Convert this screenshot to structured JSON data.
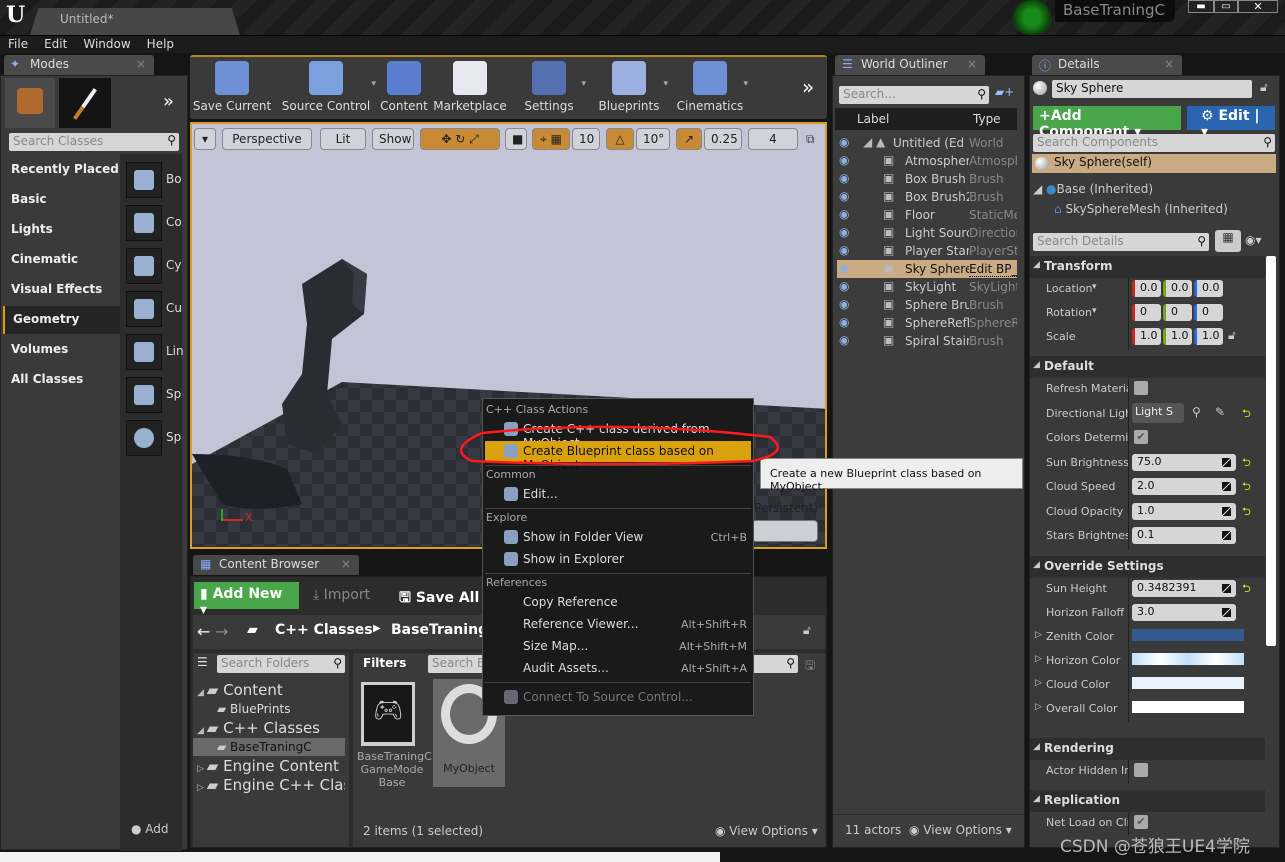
{
  "window": {
    "tab": "Untitled*",
    "project": "BaseTraningC",
    "controls": [
      "minimize",
      "maximize",
      "close"
    ]
  },
  "menu": [
    "File",
    "Edit",
    "Window",
    "Help"
  ],
  "modes": {
    "tab": "Modes",
    "search_placeholder": "Search Classes",
    "categories": [
      "Recently Placed",
      "Basic",
      "Lights",
      "Cinematic",
      "Visual Effects",
      "Geometry",
      "Volumes",
      "All Classes"
    ],
    "selected": "Geometry",
    "items": [
      "Bo",
      "Co",
      "Cy",
      "Cu",
      "Lin",
      "Sp",
      "Sp"
    ],
    "footer": "Add"
  },
  "toolbar": [
    {
      "label": "Save Current",
      "icon": "floppy-icon",
      "color": "#6d8fd6"
    },
    {
      "label": "Source Control",
      "icon": "source-control-icon",
      "color": "#7aa0e0",
      "dropdown": true
    },
    {
      "label": "Content",
      "icon": "content-icon",
      "color": "#5b7fd0"
    },
    {
      "label": "Marketplace",
      "icon": "marketplace-icon",
      "color": "#e8e8f0"
    },
    {
      "label": "Settings",
      "icon": "settings-icon",
      "color": "#5470b0",
      "dropdown": true
    },
    {
      "label": "Blueprints",
      "icon": "blueprints-icon",
      "color": "#9bb0e0",
      "dropdown": true
    },
    {
      "label": "Cinematics",
      "icon": "cinematics-icon",
      "color": "#6d8fd6",
      "dropdown": true
    }
  ],
  "viewport": {
    "view": "Perspective",
    "lit": "Lit",
    "show": "Show",
    "grid_snap": "10",
    "rotation_snap": "10°",
    "scale_snap": "0.25",
    "camera_speed": "4",
    "level_text": "Persistent)",
    "axis_x": "X"
  },
  "content_browser": {
    "tab": "Content Browser",
    "add_new": "Add New",
    "import": "Import",
    "save_all": "Save All",
    "path": [
      "C++ Classes",
      "BaseTraningC"
    ],
    "search_folders": "Search Folders",
    "filters": "Filters",
    "search_assets": "Search Ba",
    "tree": [
      {
        "label": "Content",
        "level": 0,
        "expanded": true
      },
      {
        "label": "BluePrints",
        "level": 1
      },
      {
        "label": "C++ Classes",
        "level": 0,
        "expanded": true
      },
      {
        "label": "BaseTraningC",
        "level": 1,
        "selected": true
      },
      {
        "label": "Engine Content",
        "level": 0
      },
      {
        "label": "Engine C++ Class",
        "level": 0
      }
    ],
    "assets": [
      {
        "label": "BaseTraningC GameMode Base"
      },
      {
        "label": "MyObject",
        "selected": true
      }
    ],
    "status": "2 items (1 selected)",
    "view_options": "View Options"
  },
  "context_menu": {
    "sections": [
      {
        "header": "C++ Class Actions",
        "items": [
          {
            "label": "Create C++ class derived from MyObject"
          },
          {
            "label": "Create Blueprint class based on MyObject",
            "highlighted": true
          }
        ]
      },
      {
        "header": "Common",
        "items": [
          {
            "label": "Edit..."
          }
        ]
      },
      {
        "header": "Explore",
        "items": [
          {
            "label": "Show in Folder View",
            "shortcut": "Ctrl+B"
          },
          {
            "label": "Show in Explorer"
          }
        ]
      },
      {
        "header": "References",
        "items": [
          {
            "label": "Copy Reference"
          },
          {
            "label": "Reference Viewer...",
            "shortcut": "Alt+Shift+R"
          },
          {
            "label": "Size Map...",
            "shortcut": "Alt+Shift+M"
          },
          {
            "label": "Audit Assets...",
            "shortcut": "Alt+Shift+A"
          }
        ]
      },
      {
        "header": "",
        "items": [
          {
            "label": "Connect To Source Control...",
            "disabled": true
          }
        ]
      }
    ]
  },
  "tooltip": "Create a new Blueprint class based on MyObject.",
  "outliner": {
    "tab": "World Outliner",
    "search_placeholder": "Search...",
    "col_label": "Label",
    "col_type": "Type",
    "rows": [
      {
        "label": "Untitled (Editc",
        "type": "World",
        "root": true
      },
      {
        "label": "Atmospheri",
        "type": "Atmosph"
      },
      {
        "label": "Box Brush",
        "type": "Brush"
      },
      {
        "label": "Box Brush2",
        "type": "Brush"
      },
      {
        "label": "Floor",
        "type": "StaticMe"
      },
      {
        "label": "Light Sourc",
        "type": "Direction"
      },
      {
        "label": "Player Start",
        "type": "PlayerSt"
      },
      {
        "label": "Sky Sphere",
        "type": "Edit BP_",
        "selected": true
      },
      {
        "label": "SkyLight",
        "type": "SkyLight"
      },
      {
        "label": "Sphere Brus",
        "type": "Brush"
      },
      {
        "label": "SphereRefle",
        "type": "SphereR"
      },
      {
        "label": "Spiral Stair",
        "type": "Brush"
      }
    ],
    "actors": "11 actors",
    "view_options": "View Options"
  },
  "details": {
    "tab": "Details",
    "name": "Sky Sphere",
    "add_component": "Add Component",
    "edit": "Edit",
    "search_components": "Search Components",
    "components": [
      {
        "label": "Sky Sphere(self)",
        "selected": true
      },
      {
        "label": "Base (Inherited)"
      },
      {
        "label": "SkySphereMesh (Inherited)"
      }
    ],
    "search_details": "Search Details",
    "sections": [
      {
        "header": "Transform",
        "rows": [
          {
            "label": "Location",
            "vec": [
              "0.0",
              "0.0",
              "0.0"
            ]
          },
          {
            "label": "Rotation",
            "vec": [
              "0",
              "0",
              "0"
            ]
          },
          {
            "label": "Scale",
            "vec": [
              "1.0",
              "1.0",
              "1.0"
            ]
          }
        ]
      },
      {
        "header": "Default",
        "rows": [
          {
            "label": "Refresh Material",
            "check": false
          },
          {
            "label": "Directional Light",
            "combo": "Light S"
          },
          {
            "label": "Colors Determined",
            "check": true
          },
          {
            "label": "Sun Brightness",
            "value": "75.0",
            "reset": true
          },
          {
            "label": "Cloud Speed",
            "value": "2.0",
            "reset": true
          },
          {
            "label": "Cloud Opacity",
            "value": "1.0",
            "reset": true
          },
          {
            "label": "Stars Brightness",
            "value": "0.1"
          }
        ]
      },
      {
        "header": "Override Settings",
        "rows": [
          {
            "label": "Sun Height",
            "value": "0.3482391",
            "reset": true
          },
          {
            "label": "Horizon Falloff",
            "value": "3.0"
          },
          {
            "label": "Zenith Color",
            "color": "#34598f"
          },
          {
            "label": "Horizon Color",
            "color": "#bfe0fb"
          },
          {
            "label": "Cloud Color",
            "color": "#eaf3fd"
          },
          {
            "label": "Overall Color",
            "color": "#ffffff"
          }
        ]
      },
      {
        "header": "Rendering",
        "rows": [
          {
            "label": "Actor Hidden In Game",
            "check": false
          }
        ]
      },
      {
        "header": "Replication",
        "rows": [
          {
            "label": "Net Load on Client",
            "check": true
          }
        ]
      }
    ]
  },
  "watermark": "CSDN @苍狼王UE4学院",
  "colors": {
    "accent": "#d9a20c",
    "add_green": "#4aa64a",
    "edit_blue": "#2a66b0",
    "selection": "#c9aa83",
    "annotation_red": "#ff1a1a"
  }
}
